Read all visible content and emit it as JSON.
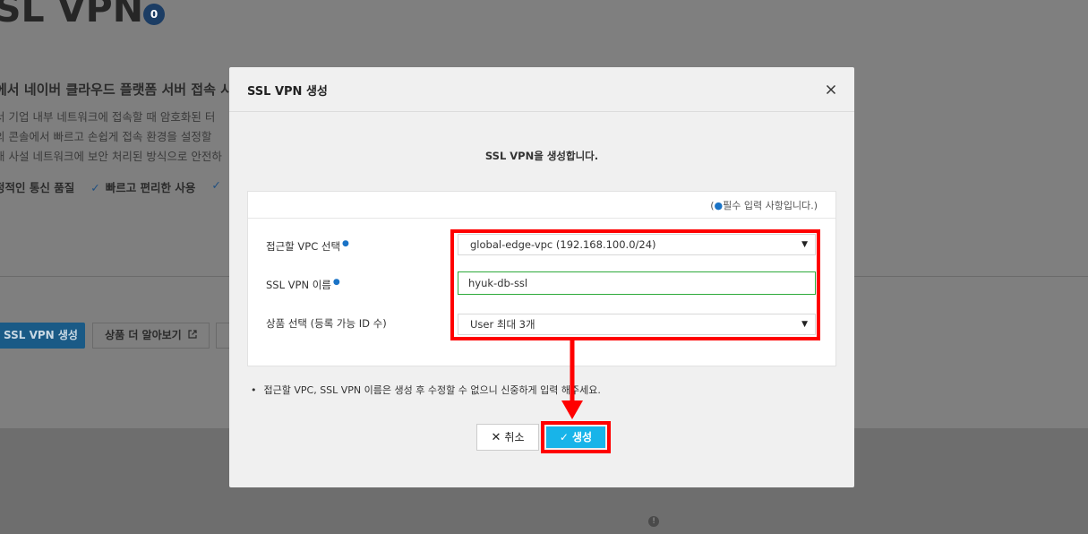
{
  "background": {
    "title": "SL VPN",
    "count": "0",
    "subtitle": "에서 네이버 클라우드 플랫폼 서버 접속 시",
    "desc_lines": [
      "서 기업 내부 네트워크에 접속할 때 암호화된 터",
      "의 콘솔에서 빠르고 손쉽게 접속 환경을 설정할",
      "내 사설 네트워크에 보안 처리된 방식으로 안전하"
    ],
    "features": [
      "정적인 통신 품질",
      "빠르고 편리한 사용"
    ],
    "primary_button": "SSL VPN 생성",
    "learn_more_button": "상품 더 알아보기"
  },
  "modal": {
    "title": "SSL VPN 생성",
    "message": "SSL VPN을 생성합니다.",
    "required_note_prefix": "(",
    "required_note_text": "필수 입력 사항입니다.)",
    "fields": {
      "vpc": {
        "label": "접근할 VPC 선택",
        "value": "global-edge-vpc (192.168.100.0/24)"
      },
      "name": {
        "label": "SSL VPN 이름",
        "value": "hyuk-db-ssl"
      },
      "product": {
        "label": "상품 선택 (등록 가능 ID 수)",
        "value": "User 최대 3개"
      }
    },
    "bullet_note": "접근할 VPC, SSL VPN 이름은 생성 후 수정할 수 없으니 신중하게 입력 해주세요.",
    "cancel_label": "취소",
    "create_label": "생성"
  },
  "colors": {
    "accent": "#18b4e9",
    "highlight": "#ff0000",
    "required_dot": "#1a73c6",
    "input_focus": "#2eaa3b"
  }
}
